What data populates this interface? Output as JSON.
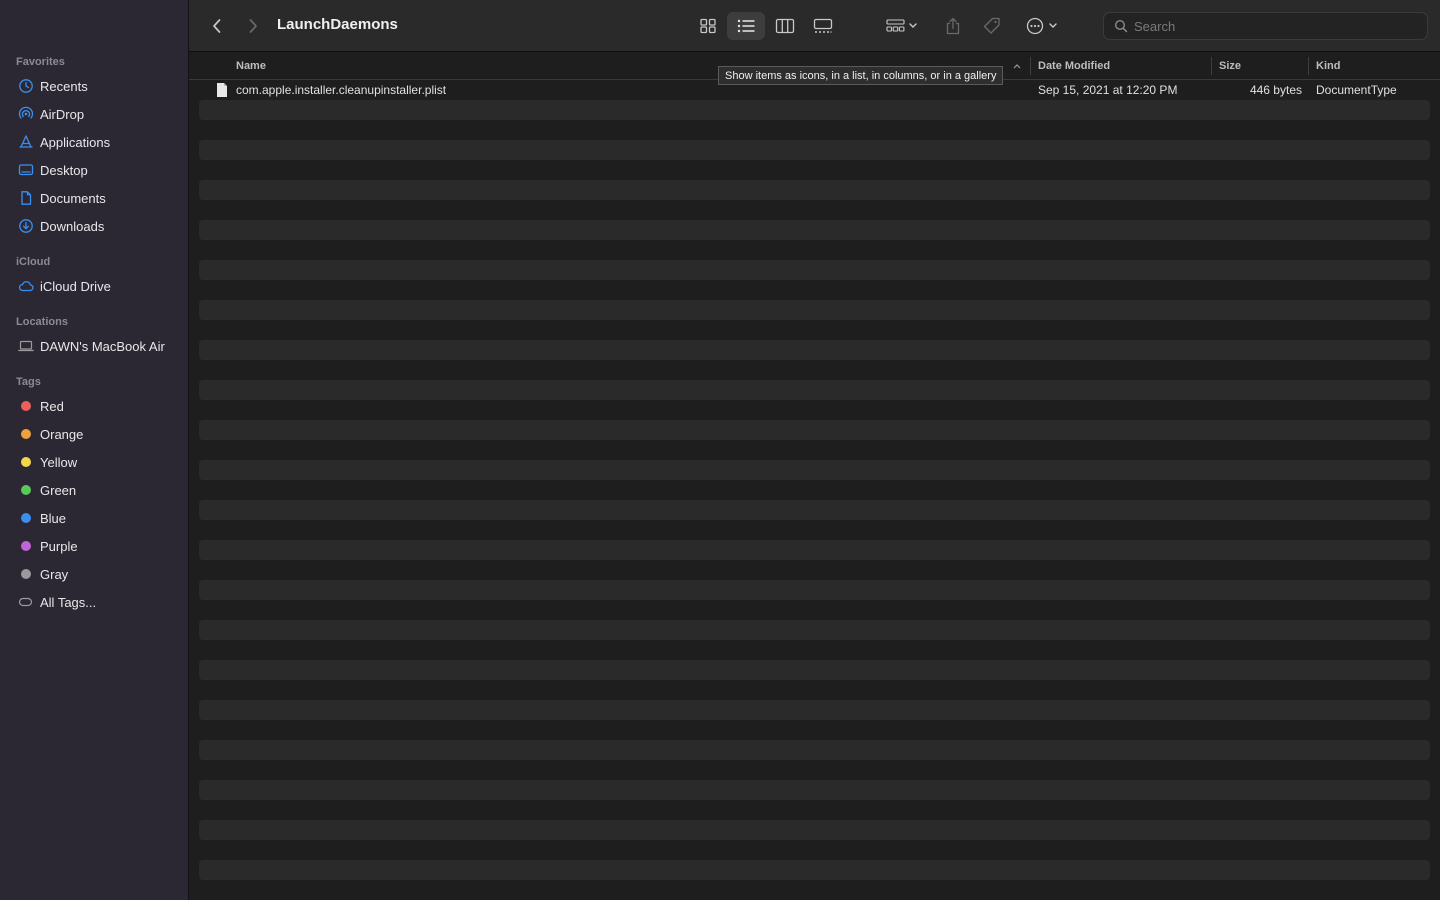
{
  "sidebar": {
    "favorites_header": "Favorites",
    "favorites": [
      {
        "label": "Recents",
        "icon": "clock-icon"
      },
      {
        "label": "AirDrop",
        "icon": "airdrop-icon"
      },
      {
        "label": "Applications",
        "icon": "applications-icon"
      },
      {
        "label": "Desktop",
        "icon": "desktop-icon"
      },
      {
        "label": "Documents",
        "icon": "document-icon"
      },
      {
        "label": "Downloads",
        "icon": "download-icon"
      }
    ],
    "icloud_header": "iCloud",
    "icloud": [
      {
        "label": "iCloud Drive",
        "icon": "cloud-icon"
      }
    ],
    "locations_header": "Locations",
    "locations": [
      {
        "label": "DAWN's MacBook Air",
        "icon": "laptop-icon"
      }
    ],
    "tags_header": "Tags",
    "tags": [
      {
        "label": "Red",
        "color": "#ec5f5d"
      },
      {
        "label": "Orange",
        "color": "#f0a03c"
      },
      {
        "label": "Yellow",
        "color": "#f5d64b"
      },
      {
        "label": "Green",
        "color": "#5ac85a"
      },
      {
        "label": "Blue",
        "color": "#3b8ff0"
      },
      {
        "label": "Purple",
        "color": "#c065d8"
      },
      {
        "label": "Gray",
        "color": "#9a9a9e"
      }
    ],
    "all_tags": "All Tags..."
  },
  "toolbar": {
    "title": "LaunchDaemons",
    "search_placeholder": "Search",
    "tooltip": "Show items as icons, in a list, in columns, or in a gallery"
  },
  "columns": {
    "name": "Name",
    "date": "Date Modified",
    "size": "Size",
    "kind": "Kind"
  },
  "files": [
    {
      "name": "com.apple.installer.cleanupinstaller.plist",
      "date": "Sep 15, 2021 at 12:20 PM",
      "size": "446 bytes",
      "kind": "DocumentType"
    }
  ],
  "colors": {
    "accent": "#3b8ff0",
    "sidebar_bg": "#2b2834"
  }
}
